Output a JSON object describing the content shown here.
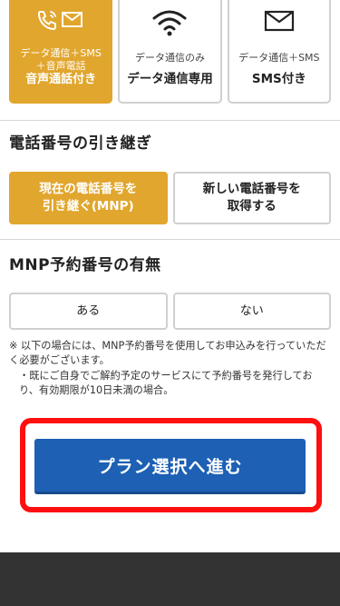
{
  "plans": [
    {
      "sub1": "データ通信＋SMS",
      "sub2": "＋音声電話",
      "main": "音声通話付き",
      "icons": [
        "phone-icon",
        "envelope-icon"
      ],
      "selected": true
    },
    {
      "sub1": "データ通信のみ",
      "main": "データ通信専用",
      "icons": [
        "wifi-icon"
      ],
      "selected": false
    },
    {
      "sub1": "データ通信＋SMS",
      "main": "SMS付き",
      "icons": [
        "envelope-icon"
      ],
      "selected": false
    }
  ],
  "number_transfer": {
    "title": "電話番号の引き継ぎ",
    "options": [
      {
        "line1": "現在の電話番号を",
        "line2": "引き継ぐ(MNP)",
        "selected": true
      },
      {
        "line1": "新しい電話番号を",
        "line2": "取得する",
        "selected": false
      }
    ]
  },
  "mnp_reservation": {
    "title": "MNP予約番号の有無",
    "options": [
      {
        "label": "ある",
        "selected": false
      },
      {
        "label": "ない",
        "selected": false
      }
    ]
  },
  "notes": {
    "line1": "※ 以下の場合には、MNP予約番号を使用してお申込みを行っていただく必要がございます。",
    "line2": "・既にご自身でご解約予定のサービスにて予約番号を発行しており、有効期限が10日未満の場合。"
  },
  "cta": {
    "label": "プラン選択へ進む"
  },
  "colors": {
    "accent": "#e1a62d",
    "primary_button": "#1d60b4",
    "highlight_frame": "#ff0f0f",
    "footer": "#333333"
  }
}
